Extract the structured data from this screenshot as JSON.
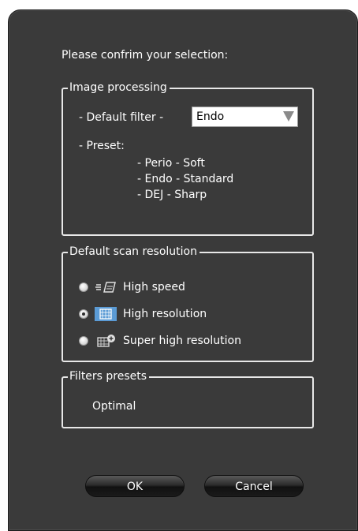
{
  "prompt": "Please confrim your selection:",
  "image_processing": {
    "title": "Image processing",
    "default_filter_label": "-   Default filter -",
    "default_filter_value": "Endo",
    "preset_label": "-   Preset:",
    "presets": [
      "-   Perio - Soft",
      "-   Endo - Standard",
      "-   DEJ - Sharp"
    ]
  },
  "scan_resolution": {
    "title": "Default scan resolution",
    "options": [
      {
        "label": "High speed",
        "icon": "high-speed-icon",
        "checked": false
      },
      {
        "label": "High resolution",
        "icon": "high-resolution-icon",
        "checked": true
      },
      {
        "label": "Super high resolution",
        "icon": "super-high-resolution-icon",
        "checked": false
      }
    ]
  },
  "filters_presets": {
    "title": "Filters presets",
    "value": "Optimal"
  },
  "buttons": {
    "ok": "OK",
    "cancel": "Cancel"
  }
}
